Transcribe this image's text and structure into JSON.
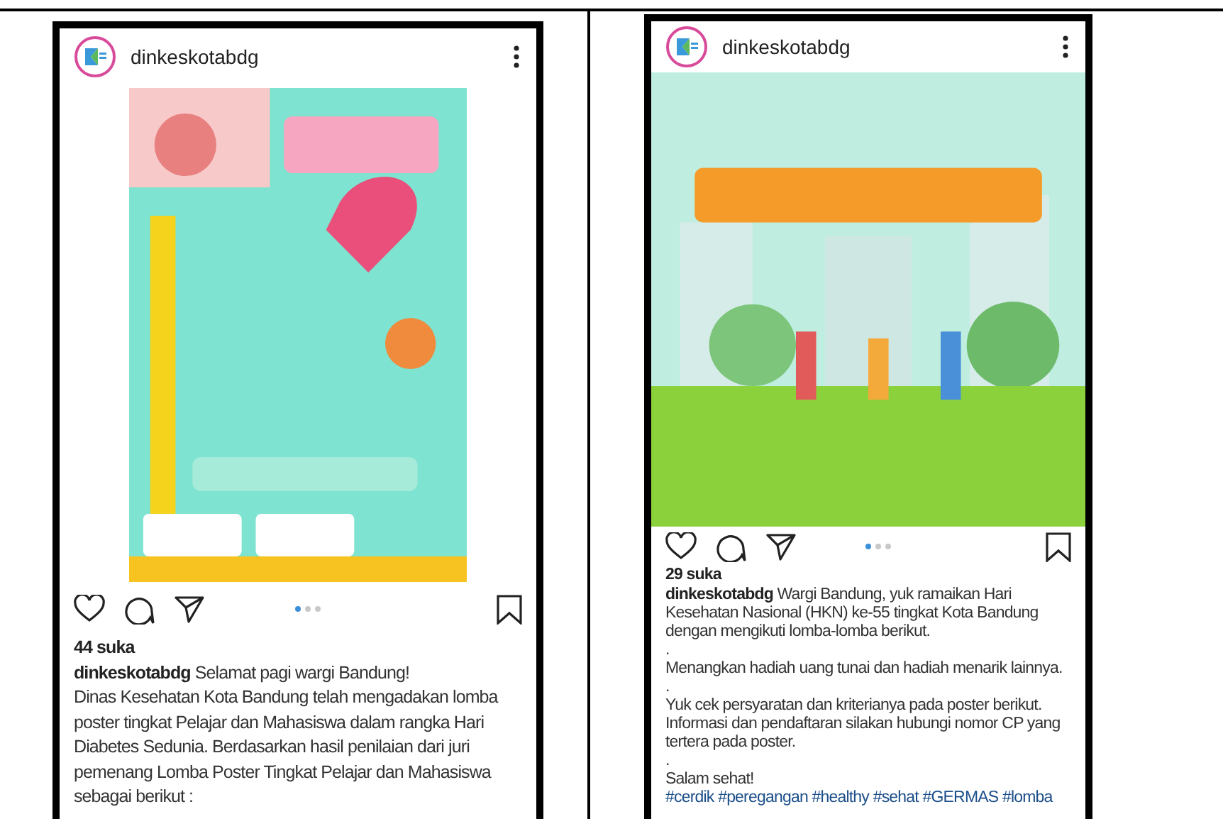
{
  "posts": [
    {
      "username": "dinkeskotabdg",
      "likes": "44 suka",
      "slides": [
        {
          "selected": true
        },
        {
          "selected": false
        },
        {
          "selected": false
        }
      ],
      "caption": [
        "**dinkeskotabdg** Selamat pagi wargi Bandung!",
        "Dinas Kesehatan Kota Bandung telah mengadakan lomba poster tingkat Pelajar dan Mahasiswa dalam rangka Hari Diabetes Sedunia. Berdasarkan hasil penilaian dari juri pemenang Lomba Poster Tingkat Pelajar dan Mahasiswa sebagai berikut :"
      ]
    },
    {
      "username": "dinkeskotabdg",
      "likes": "29 suka",
      "slides": [
        {
          "selected": true
        },
        {
          "selected": false
        },
        {
          "selected": false
        }
      ],
      "caption": [
        "**dinkeskotabdg** Wargi Bandung, yuk ramaikan Hari Kesehatan Nasional (HKN) ke-55 tingkat Kota Bandung dengan mengikuti lomba-lomba berikut.",
        ".",
        "Menangkan hadiah uang tunai dan hadiah menarik lainnya.",
        ".",
        "Yuk cek persyaratan dan kriterianya pada poster berikut. Informasi dan pendaftaran silakan hubungi nomor CP yang tertera pada poster.",
        ".",
        "Salam sehat!"
      ],
      "hashtags": "#cerdik #peregangan #healthy #sehat #GERMAS #lomba"
    }
  ]
}
